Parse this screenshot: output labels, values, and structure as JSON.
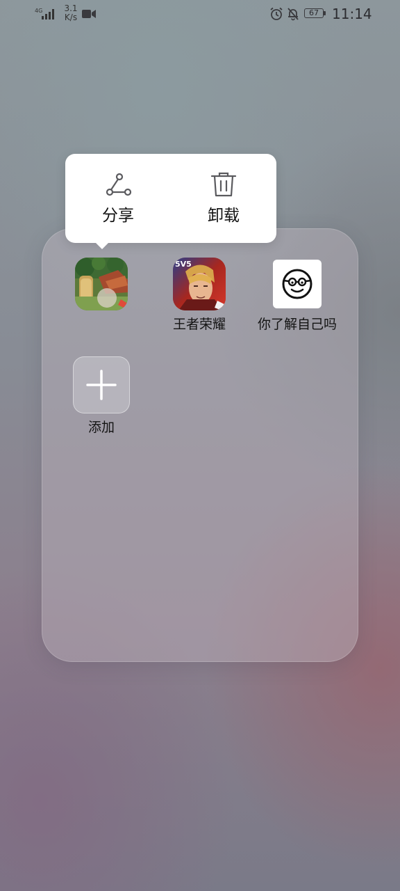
{
  "status_bar": {
    "network_type": "4G",
    "net_speed_value": "3.1",
    "net_speed_unit": "K/s",
    "battery_level": "67",
    "time": "11:14",
    "icons": [
      "signal-icon",
      "video-recording-icon",
      "alarm-icon",
      "bell-off-icon",
      "battery-icon"
    ]
  },
  "popup_menu": {
    "items": [
      {
        "label": "分享",
        "icon": "share-icon"
      },
      {
        "label": "卸载",
        "icon": "trash-icon"
      }
    ]
  },
  "folder": {
    "apps": [
      {
        "label": "",
        "icon": "farm-game-icon"
      },
      {
        "label": "王者荣耀",
        "icon": "kings-glory-icon"
      },
      {
        "label": "你了解自己吗",
        "icon": "nerd-face-icon"
      }
    ],
    "add_label": "添加"
  },
  "colors": {
    "menu_background": "#ffffff",
    "folder_background": "#bdb5bd",
    "kings_glory_red": "#c4261f"
  }
}
